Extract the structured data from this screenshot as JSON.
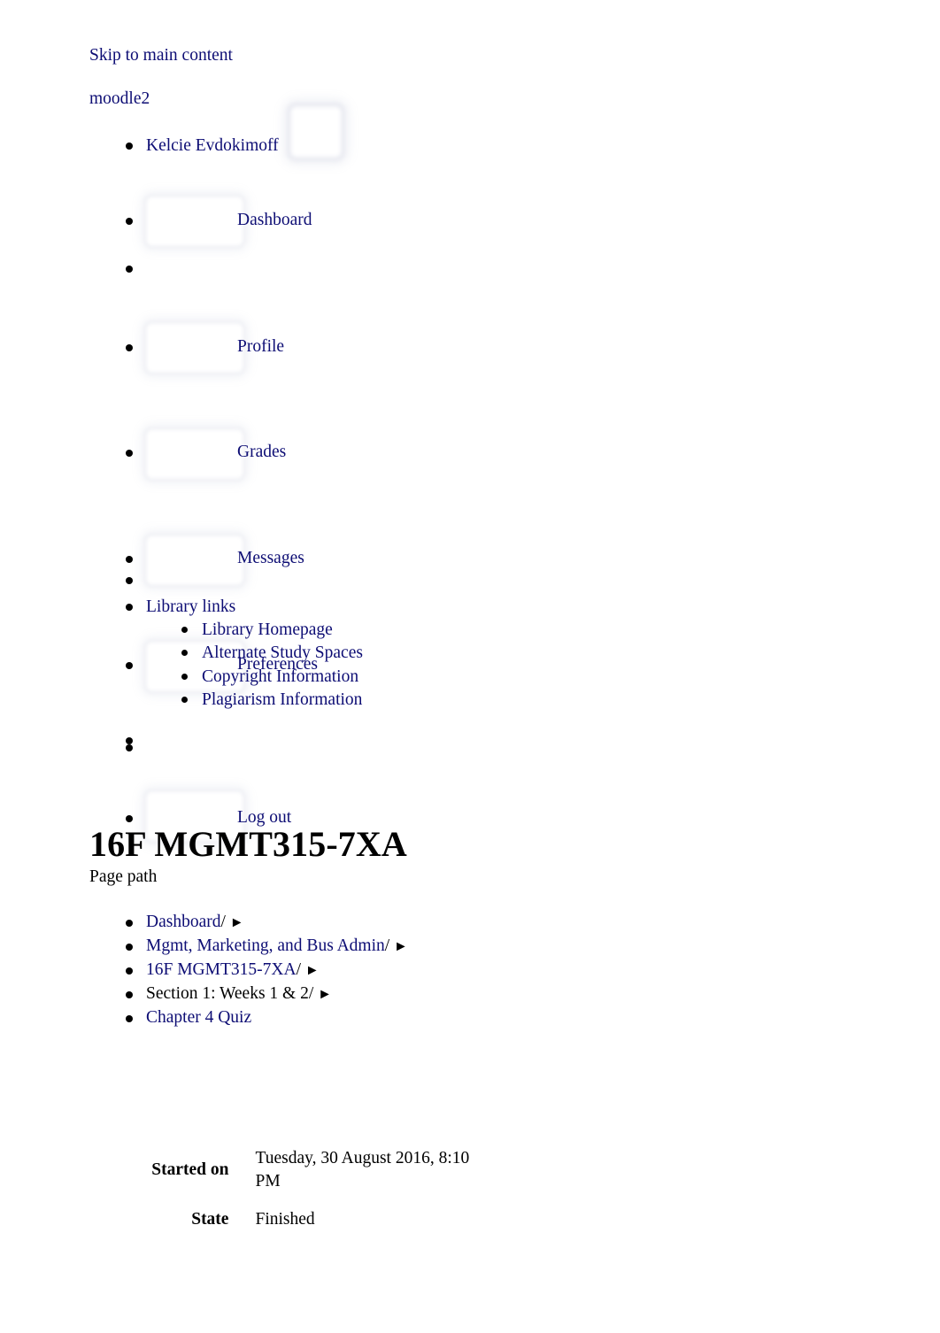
{
  "accessibility": {
    "skip_link": "Skip to main content"
  },
  "site": {
    "name": "moodle2"
  },
  "user_menu": {
    "user_name": "Kelcie Evdokimoff",
    "avatar_icon": "broken-avatar-image",
    "items": [
      {
        "label": "Dashboard",
        "icon": "broken-image-placeholder",
        "has_icon": true,
        "empty": false
      },
      {
        "label": "",
        "icon": "",
        "has_icon": false,
        "empty": true
      },
      {
        "label": "Profile",
        "icon": "broken-image-placeholder",
        "has_icon": true,
        "empty": false
      },
      {
        "label": "Grades",
        "icon": "broken-image-placeholder",
        "has_icon": true,
        "empty": false
      },
      {
        "label": "Messages",
        "icon": "broken-image-placeholder",
        "has_icon": true,
        "empty": false
      },
      {
        "label": "Preferences",
        "icon": "broken-image-placeholder",
        "has_icon": true,
        "empty": false
      },
      {
        "label": "",
        "icon": "",
        "has_icon": false,
        "empty": true
      },
      {
        "label": "Log out",
        "icon": "broken-image-placeholder",
        "has_icon": true,
        "empty": false
      }
    ]
  },
  "library": {
    "spacer_bullet": "",
    "title": "Library links",
    "links": [
      "Library Homepage",
      "Alternate Study Spaces",
      "Copyright Information",
      "Plagiarism Information"
    ],
    "trailing_bullet": ""
  },
  "header": {
    "course_title": "16F MGMT315-7XA",
    "page_path_label": "Page path"
  },
  "breadcrumb": {
    "separator": "/",
    "arrow": "►",
    "items": [
      {
        "label": "Dashboard",
        "is_link": true,
        "has_separator": true
      },
      {
        "label": "Mgmt, Marketing, and Bus Admin",
        "is_link": true,
        "has_separator": true
      },
      {
        "label": "16F MGMT315-7XA",
        "is_link": true,
        "has_separator": true
      },
      {
        "label": "Section 1: Weeks 1 & 2",
        "is_link": false,
        "has_separator": true
      },
      {
        "label": "Chapter 4 Quiz",
        "is_link": true,
        "has_separator": false
      }
    ]
  },
  "quiz_summary": {
    "rows": [
      {
        "label": "Started on",
        "value": "Tuesday, 30 August 2016, 8:10 PM"
      },
      {
        "label": "State",
        "value": "Finished"
      }
    ]
  },
  "colors": {
    "link": "#0d0d74",
    "text": "#000000",
    "background": "#ffffff"
  }
}
